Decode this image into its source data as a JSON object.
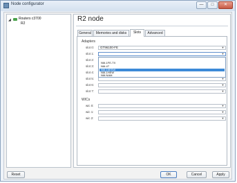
{
  "window": {
    "title": "Node configurator",
    "controls": [
      "—",
      "□",
      "✕"
    ]
  },
  "tree": {
    "items": [
      {
        "label": "Routers c3700",
        "expanded": true
      },
      {
        "label": "R2"
      }
    ]
  },
  "panel": {
    "title": "R2 node",
    "tabs": [
      {
        "label": "General",
        "active": false
      },
      {
        "label": "Memories and disks",
        "active": false
      },
      {
        "label": "Slots",
        "active": true
      },
      {
        "label": "Advanced",
        "active": false
      }
    ],
    "adapters_label": "Adapters",
    "slots": [
      {
        "label": "slot 0:",
        "value": "GT96100-FE"
      },
      {
        "label": "slot 1:",
        "value": ""
      },
      {
        "label": "slot 2:",
        "value": ""
      },
      {
        "label": "slot 3:",
        "value": ""
      },
      {
        "label": "slot 4:",
        "value": ""
      },
      {
        "label": "slot 5:",
        "value": ""
      },
      {
        "label": "slot 6:",
        "value": ""
      },
      {
        "label": "slot 7:",
        "value": ""
      }
    ],
    "wics_label": "WICs",
    "wics": [
      {
        "label": "wic 0:",
        "value": ""
      },
      {
        "label": "wic 1:",
        "value": ""
      },
      {
        "label": "wic 2:",
        "value": ""
      }
    ],
    "dropdown": {
      "options": [
        "",
        "NM-1FE-TX",
        "NM-4T",
        "NM-16ESW",
        "NM-1HEW",
        "NM-NAM"
      ],
      "selected_index": 3
    }
  },
  "buttons": {
    "reset": "Reset",
    "ok": "OK",
    "cancel": "Cancel",
    "apply": "Apply"
  }
}
